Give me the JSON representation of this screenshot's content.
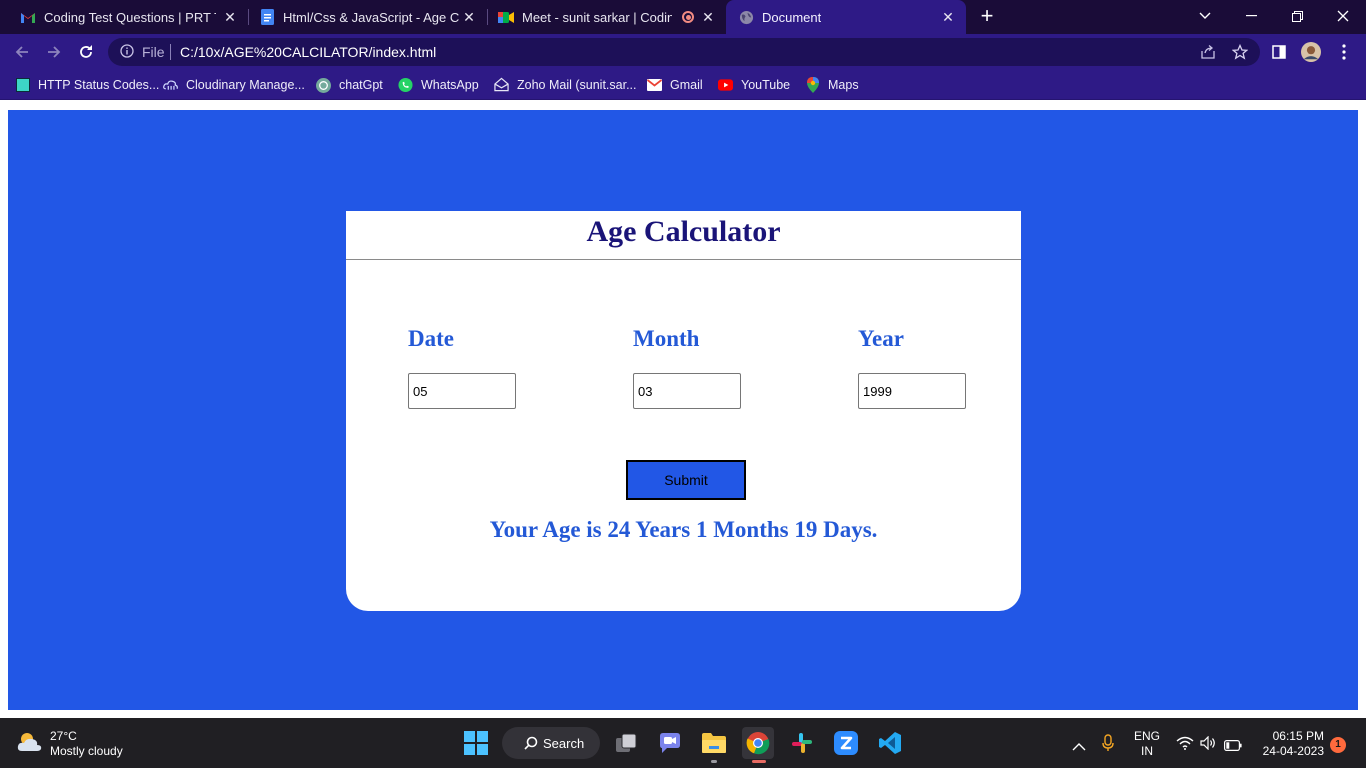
{
  "browser": {
    "tabs": [
      {
        "title": "Coding Test Questions | PRT Test",
        "icon": "gmail-icon"
      },
      {
        "title": "Html/Css & JavaScript - Age Calc",
        "icon": "google-docs-icon"
      },
      {
        "title": "Meet - sunit sarkar | Coding",
        "icon": "google-meet-icon"
      },
      {
        "title": "Document",
        "icon": "globe-icon",
        "active": true
      }
    ],
    "address": {
      "scheme_label": "File",
      "url": "C:/10x/AGE%20CALCILATOR/index.html"
    },
    "bookmarks": [
      {
        "label": "HTTP Status Codes...",
        "icon": "bookmark-square-icon"
      },
      {
        "label": "Cloudinary Manage...",
        "icon": "cloudinary-icon"
      },
      {
        "label": "chatGpt",
        "icon": "openai-icon"
      },
      {
        "label": "WhatsApp",
        "icon": "whatsapp-icon"
      },
      {
        "label": "Zoho Mail (sunit.sar...",
        "icon": "zoho-mail-icon"
      },
      {
        "label": "Gmail",
        "icon": "gmail-icon"
      },
      {
        "label": "YouTube",
        "icon": "youtube-icon"
      },
      {
        "label": "Maps",
        "icon": "maps-pin-icon"
      }
    ]
  },
  "page": {
    "title": "Age Calculator",
    "fields": {
      "date": {
        "label": "Date",
        "value": "05"
      },
      "month": {
        "label": "Month",
        "value": "03"
      },
      "year": {
        "label": "Year",
        "value": "1999"
      }
    },
    "submit_label": "Submit",
    "result": "Your Age is 24 Years 1 Months 19 Days."
  },
  "taskbar": {
    "weather": {
      "temp": "27°C",
      "condition": "Mostly cloudy"
    },
    "search_label": "Search",
    "language": {
      "code": "ENG",
      "region": "IN"
    },
    "clock": {
      "time": "06:15 PM",
      "date": "24-04-2023"
    },
    "notification_count": "1"
  },
  "colors": {
    "page_background": "#2257e6",
    "title_color": "#1a1478",
    "label_color": "#2459d6",
    "browser_frame": "#2e1a86",
    "tab_strip": "#1a0c38"
  }
}
